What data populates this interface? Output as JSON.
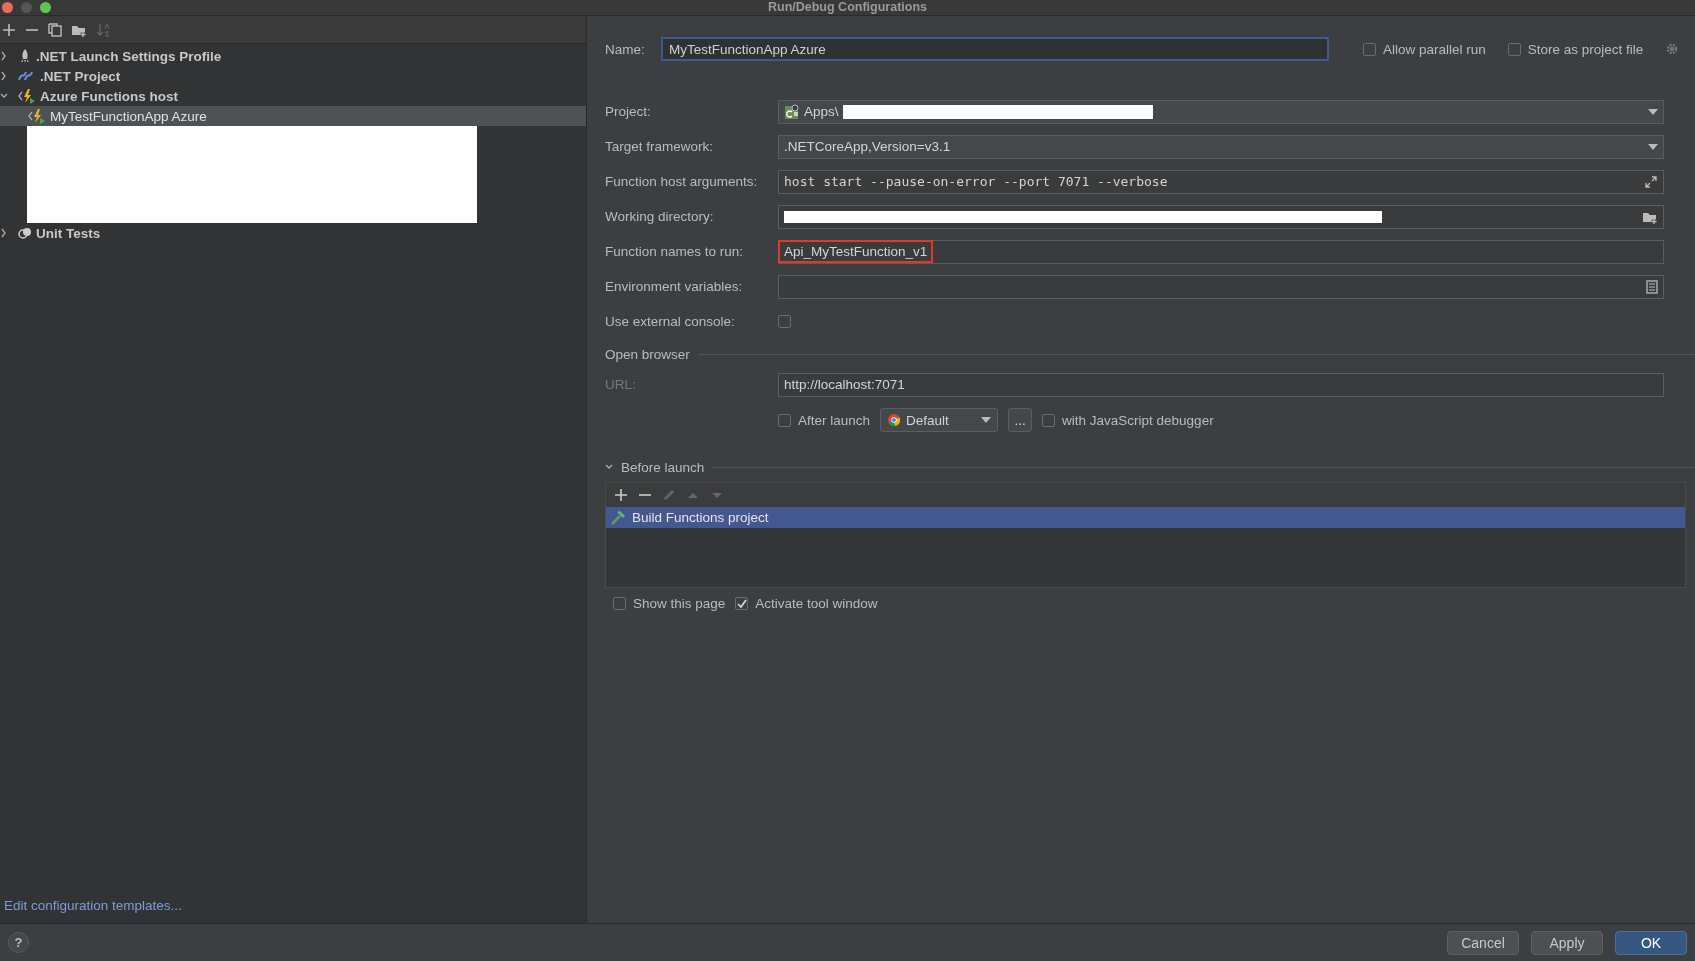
{
  "window": {
    "title": "Run/Debug Configurations"
  },
  "toolbar": [
    {
      "kind": "add",
      "disabled": false
    },
    {
      "kind": "remove",
      "disabled": false
    },
    {
      "kind": "copy",
      "disabled": false
    },
    {
      "kind": "folder",
      "disabled": false
    },
    {
      "kind": "sort",
      "disabled": true
    }
  ],
  "tree": [
    {
      "kind": "node",
      "label": ".NET Launch Settings Profile",
      "expanded": false,
      "selected": false
    },
    {
      "kind": "node",
      "label": ".NET Project",
      "expanded": false,
      "selected": false
    },
    {
      "kind": "node",
      "label": "Azure Functions host",
      "expanded": true,
      "selected": false,
      "children": [
        {
          "kind": "node",
          "label": "MyTestFunctionApp Azure",
          "selected": true
        },
        {
          "kind": "redacted"
        }
      ]
    },
    {
      "kind": "node",
      "label": "Unit Tests",
      "expanded": false,
      "selected": false
    }
  ],
  "edit_templates_link": "Edit configuration templates...",
  "help_button": "?",
  "name": {
    "label": "Name:",
    "value": "MyTestFunctionApp Azure"
  },
  "header_options": [
    {
      "label": "Allow parallel run",
      "checked": false
    },
    {
      "label": "Store as project file",
      "checked": false
    }
  ],
  "fields": [
    {
      "kind": "dropdown",
      "label": "Project:",
      "value": "Apps\\",
      "redacted": true
    },
    {
      "kind": "dropdown",
      "label": "Target framework:",
      "value": ".NETCoreApp,Version=v3.1"
    },
    {
      "kind": "text",
      "label": "Function host arguments:",
      "value": "host start --pause-on-error --port 7071 --verbose"
    },
    {
      "kind": "text",
      "label": "Working directory:",
      "redacted": true
    },
    {
      "kind": "text",
      "label": "Function names to run:",
      "value": "Api_MyTestFunction_v1",
      "highlighted": true
    },
    {
      "kind": "text",
      "label": "Environment variables:"
    },
    {
      "kind": "checkbox",
      "label": "Use external console:",
      "checked": false
    }
  ],
  "open_browser": {
    "title": "Open browser",
    "url": {
      "label": "URL:",
      "value": "http://localhost:7071",
      "label_disabled": true
    },
    "after_launch": {
      "label": "After launch",
      "checked": false
    },
    "browser": {
      "value": "Default"
    },
    "more_button": "...",
    "js_debugger": {
      "label": "with JavaScript debugger",
      "checked": false
    }
  },
  "before_launch": {
    "title": "Before launch",
    "expanded": true,
    "toolbar": [
      {
        "kind": "add",
        "disabled": false
      },
      {
        "kind": "remove",
        "disabled": false
      },
      {
        "kind": "edit",
        "disabled": true
      },
      {
        "kind": "up",
        "disabled": true
      },
      {
        "kind": "down",
        "disabled": true
      }
    ],
    "tasks": [
      {
        "label": "Build Functions project",
        "selected": true
      }
    ]
  },
  "bottom_options": [
    {
      "label": "Show this page",
      "checked": false
    },
    {
      "label": "Activate tool window",
      "checked": true
    }
  ],
  "buttons": [
    {
      "label": "Cancel",
      "primary": false
    },
    {
      "label": "Apply",
      "primary": false
    },
    {
      "label": "OK",
      "primary": true
    }
  ]
}
